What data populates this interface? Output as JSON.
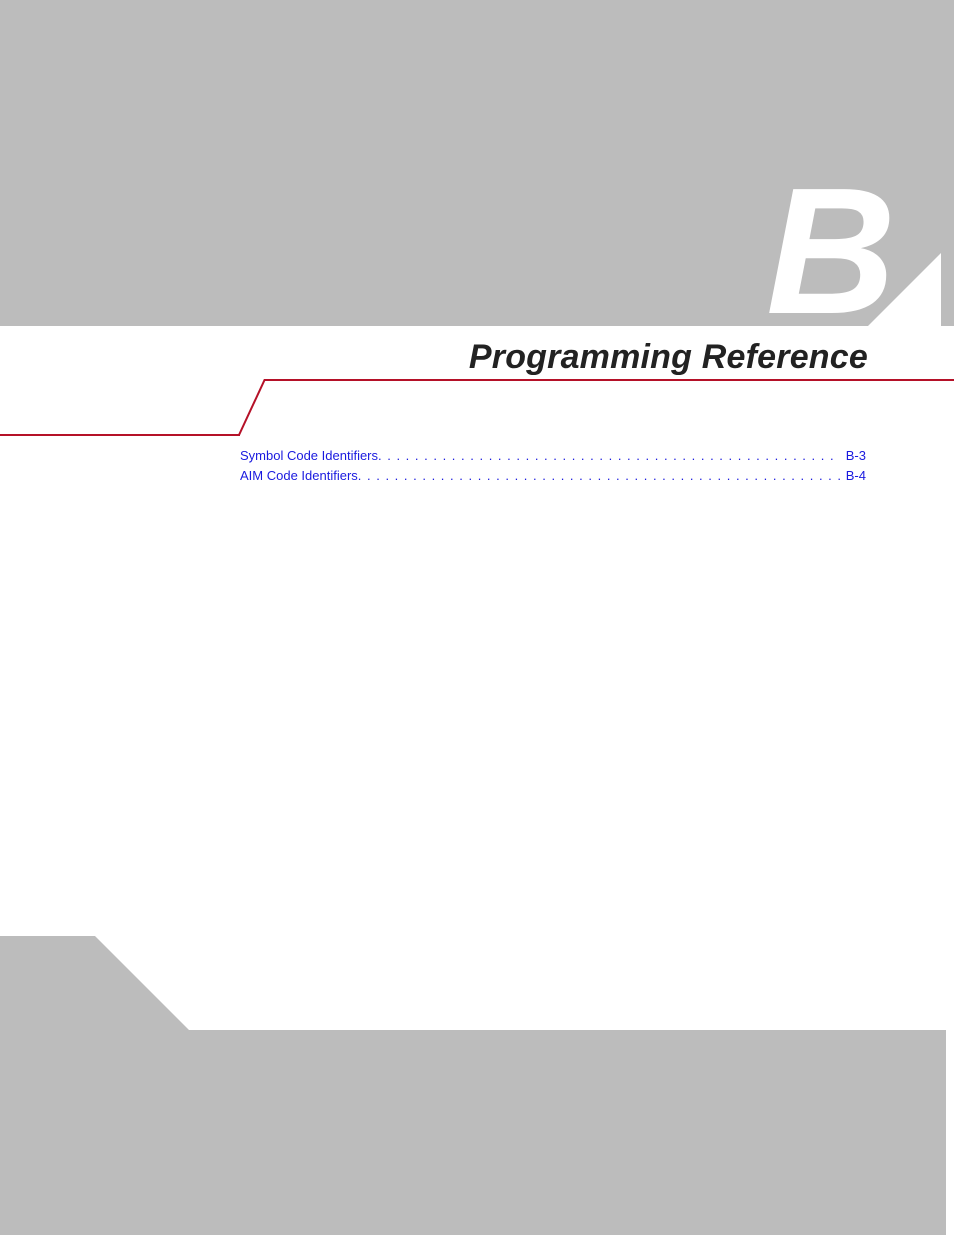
{
  "appendix": {
    "letter": "B",
    "title": "Programming Reference"
  },
  "toc": {
    "items": [
      {
        "label": "Symbol Code Identifiers",
        "page": "B-3"
      },
      {
        "label": "AIM Code Identifiers",
        "page": "B-4"
      }
    ]
  }
}
